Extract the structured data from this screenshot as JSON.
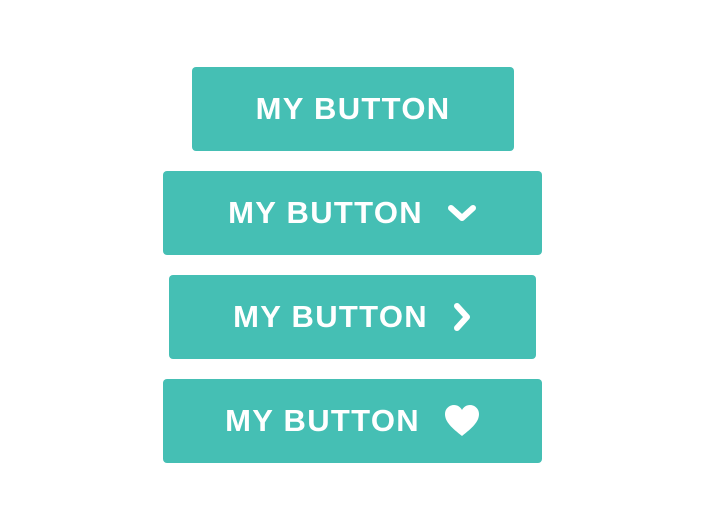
{
  "colors": {
    "button_background": "#45bfb4",
    "button_text": "#ffffff",
    "page_background": "#ffffff"
  },
  "buttons": [
    {
      "label": "MY BUTTON",
      "icon": null
    },
    {
      "label": "MY BUTTON",
      "icon": "chevron-down-icon"
    },
    {
      "label": "MY BUTTON",
      "icon": "chevron-right-icon"
    },
    {
      "label": "MY BUTTON",
      "icon": "heart-icon"
    }
  ]
}
